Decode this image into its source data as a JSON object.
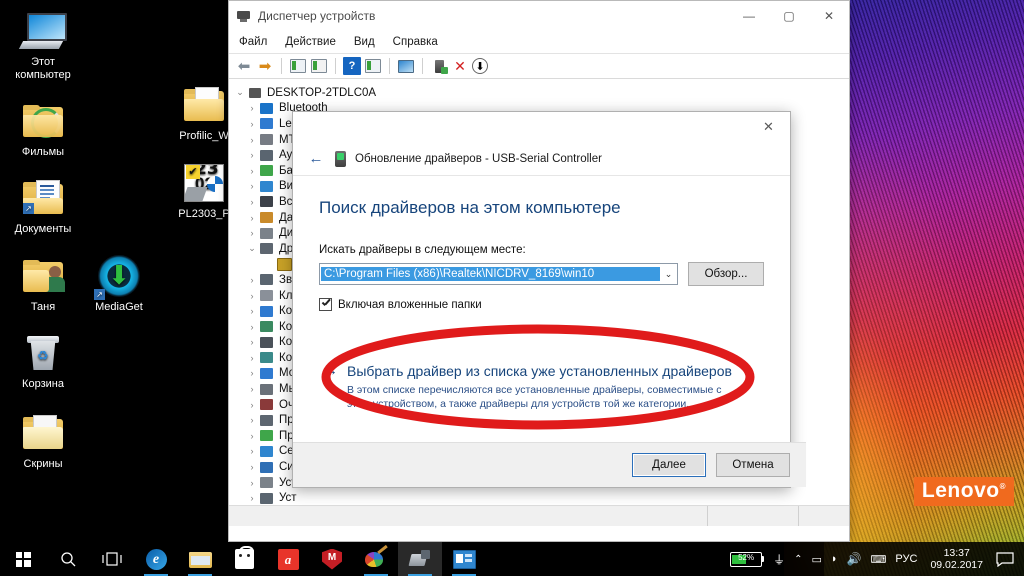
{
  "desktop": {
    "icons": [
      {
        "name": "this-pc",
        "label": "Этот\nкомпьютер",
        "label_line1": "Этот",
        "label_line2": "компьютер",
        "icon": "monitor-icon"
      },
      {
        "name": "films-folder",
        "label": "Фильмы",
        "icon": "folder-icon"
      },
      {
        "name": "documents-folder",
        "label": "Документы",
        "icon": "folder-document-icon"
      },
      {
        "name": "tanya-folder",
        "label": "Таня",
        "icon": "folder-user-icon"
      },
      {
        "name": "mediaget",
        "label": "MediaGet",
        "icon": "download-circle-icon"
      },
      {
        "name": "recycle-bin",
        "label": "Корзина",
        "icon": "trash-icon"
      },
      {
        "name": "screenshots-folder",
        "label": "Скрины",
        "icon": "folder-icon"
      },
      {
        "name": "prolific-folder",
        "label": "Profilic_W",
        "icon": "folder-icon"
      },
      {
        "name": "pl2303-installer",
        "label": "PL2303_P",
        "icon": "installer-icon"
      }
    ],
    "wallpaper_brand": "Lenovo",
    "wallpaper_brand_mark": "®"
  },
  "device_manager": {
    "title": "Диспетчер устройств",
    "window_controls": {
      "minimize": "—",
      "maximize": "▢",
      "close": "✕"
    },
    "menu": [
      "Файл",
      "Действие",
      "Вид",
      "Справка"
    ],
    "toolbar_icons": [
      "back-arrow-icon",
      "forward-arrow-icon",
      "properties-icon",
      "list-view-icon",
      "help-icon",
      "update-driver-icon",
      "scan-hardware-icon",
      "enable-device-icon",
      "uninstall-device-icon",
      "download-icon"
    ],
    "tree": {
      "root": {
        "label": "DESKTOP-2TDLC0A",
        "expanded": true,
        "icon": "computer-icon"
      },
      "nodes": [
        {
          "label": "Bluetooth",
          "icon": "bluetooth-icon",
          "expanded": false
        },
        {
          "label": "Lenovo Vhid Device",
          "icon": "monitor-icon",
          "expanded": false
        },
        {
          "label": "MT",
          "icon": "camera-icon",
          "expanded": false
        },
        {
          "label": "Ауд",
          "icon": "audio-icon",
          "expanded": false
        },
        {
          "label": "Бат",
          "icon": "battery-icon",
          "expanded": false
        },
        {
          "label": "Вид",
          "icon": "display-adapter-icon",
          "expanded": false
        },
        {
          "label": "Вст",
          "icon": "firmware-icon",
          "expanded": false
        },
        {
          "label": "Дат",
          "icon": "sensor-icon",
          "expanded": false
        },
        {
          "label": "Дис",
          "icon": "disk-drive-icon",
          "expanded": false
        },
        {
          "label": "Дру",
          "icon": "other-device-icon",
          "expanded": true
        },
        {
          "label": "",
          "icon": "warning-device-icon",
          "expanded": null,
          "child": true
        },
        {
          "label": "Зву",
          "icon": "sound-icon",
          "expanded": false
        },
        {
          "label": "Кла",
          "icon": "keyboard-icon",
          "expanded": false
        },
        {
          "label": "Ком",
          "icon": "computer-icon",
          "expanded": false
        },
        {
          "label": "Ком",
          "icon": "port-icon",
          "expanded": false
        },
        {
          "label": "Кон",
          "icon": "usb-controller-icon",
          "expanded": false
        },
        {
          "label": "Кон",
          "icon": "storage-controller-icon",
          "expanded": false
        },
        {
          "label": "Мо",
          "icon": "monitor-icon",
          "expanded": false
        },
        {
          "label": "Мы",
          "icon": "mouse-icon",
          "expanded": false
        },
        {
          "label": "Оче",
          "icon": "print-queue-icon",
          "expanded": false
        },
        {
          "label": "Про",
          "icon": "processor-icon",
          "expanded": false
        },
        {
          "label": "Про",
          "icon": "software-device-icon",
          "expanded": false
        },
        {
          "label": "Сет",
          "icon": "network-adapter-icon",
          "expanded": false
        },
        {
          "label": "Сис",
          "icon": "system-device-icon",
          "expanded": false
        },
        {
          "label": "Уст",
          "icon": "hid-device-icon",
          "expanded": false
        },
        {
          "label": "Уст",
          "icon": "portable-device-icon",
          "expanded": false
        },
        {
          "label": "Уст",
          "icon": "security-device-icon",
          "expanded": false
        }
      ]
    }
  },
  "dialog": {
    "close_label": "✕",
    "back_label": "←",
    "header": "Обновление драйверов - USB-Serial Controller",
    "heading": "Поиск драйверов на этом компьютере",
    "path_label": "Искать драйверы в следующем месте:",
    "path_value": "C:\\Program Files (x86)\\Realtek\\NICDRV_8169\\win10",
    "path_dropdown_icon": "chevron-down-icon",
    "browse_button": "Обзор...",
    "include_subfolders_label": "Включая вложенные папки",
    "include_subfolders_checked": true,
    "alt_arrow": "→",
    "alt_link": "Выбрать драйвер из списка уже установленных драйверов",
    "alt_desc": "В этом списке перечисляются все установленные драйверы, совместимые с этим устройством, а также драйверы для устройств той же категории.",
    "next_button": "Далее",
    "cancel_button": "Отмена"
  },
  "annotation": {
    "shape": "red-ellipse",
    "color": "#e01b1b"
  },
  "taskbar": {
    "start_icon": "windows-start-icon",
    "search_icon": "search-icon",
    "taskview_icon": "task-view-icon",
    "apps": [
      {
        "name": "edge",
        "icon": "edge-icon",
        "open": true
      },
      {
        "name": "file-explorer",
        "icon": "folder-icon",
        "open": true
      },
      {
        "name": "store",
        "icon": "store-icon",
        "open": false
      },
      {
        "name": "adobe-reader",
        "icon": "acrobat-icon",
        "open": false
      },
      {
        "name": "mcafee",
        "icon": "mcafee-shield-icon",
        "open": false
      },
      {
        "name": "paint",
        "icon": "paint-icon",
        "open": true
      },
      {
        "name": "device-manager",
        "icon": "device-manager-icon",
        "open": true,
        "active": true
      },
      {
        "name": "update-driver-dialog",
        "icon": "driver-dialog-icon",
        "open": true
      }
    ],
    "tray": {
      "battery_percent": "52%",
      "battery_value": 52,
      "plug_icon": "power-plug-icon",
      "chevron_icon": "chevron-up-icon",
      "hidden_icons": [
        "battery-saver-icon",
        "wifi-icon",
        "volume-icon",
        "monitor-icon",
        "keyboard-icon"
      ],
      "language": "РУС",
      "time": "13:37",
      "date": "09.02.2017",
      "action_center_icon": "notification-icon"
    }
  },
  "colors": {
    "accent_blue": "#17457c",
    "link_blue": "#2b4f87",
    "selection_blue": "#3b9ae1",
    "annotation_red": "#e01b1b",
    "battery_green": "#2fbf3f",
    "lenovo_orange": "#f06a1e"
  }
}
